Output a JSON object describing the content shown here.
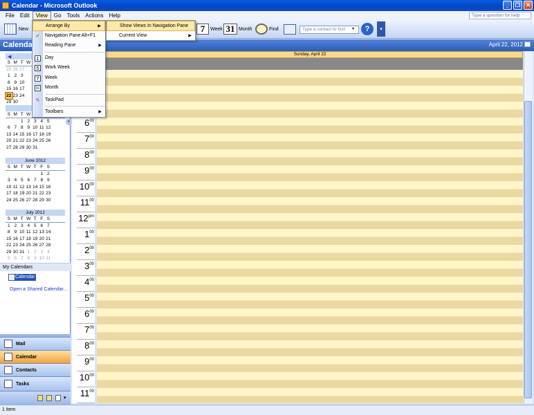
{
  "window": {
    "title": "Calendar - Microsoft Outlook"
  },
  "menubar": {
    "items": [
      "File",
      "Edit",
      "View",
      "Go",
      "Tools",
      "Actions",
      "Help"
    ],
    "help_placeholder": "Type a question for help"
  },
  "toolbar": {
    "new_label": "New",
    "week_label": "Week",
    "week_num": "7",
    "month_label": "Month",
    "month_num": "31",
    "find_label": "Find",
    "contact_placeholder": "Type a contact to find"
  },
  "view_menu": {
    "items": [
      {
        "label": "Arrange By",
        "submenu": true,
        "highlight": true
      },
      {
        "label": "Navigation Pane",
        "shortcut": "Alt+F1",
        "checked": true
      },
      {
        "label": "Reading Pane",
        "submenu": true
      },
      {
        "label": "Day",
        "icon": "1"
      },
      {
        "label": "Work Week",
        "icon": "5"
      },
      {
        "label": "Week",
        "icon": "7"
      },
      {
        "label": "Month",
        "icon": "31"
      },
      {
        "label": "TaskPad"
      },
      {
        "label": "Toolbars",
        "submenu": true
      }
    ]
  },
  "arrange_menu": {
    "items": [
      {
        "label": "Show Views In Navigation Pane",
        "highlight": true
      },
      {
        "label": "Current View",
        "submenu": true
      }
    ]
  },
  "nav": {
    "title": "Calendar",
    "my_calendars": "My Calendars",
    "calendar_item": "Calendar",
    "open_shared": "Open a Shared Calendar...",
    "buttons": [
      {
        "label": "Mail"
      },
      {
        "label": "Calendar",
        "selected": true
      },
      {
        "label": "Contacts"
      },
      {
        "label": "Tasks"
      }
    ]
  },
  "minicals": [
    {
      "title": "Apr",
      "dow": [
        "S",
        "M",
        "T",
        "W",
        "T",
        "F",
        "S"
      ],
      "rows": [
        [
          "25",
          "26",
          "27",
          "",
          "",
          "",
          ""
        ],
        [
          "1",
          "2",
          "3",
          "",
          "",
          "",
          ""
        ],
        [
          "8",
          "9",
          "10",
          "",
          "",
          "",
          ""
        ],
        [
          "15",
          "16",
          "17",
          "",
          "",
          "",
          ""
        ],
        [
          "22",
          "23",
          "24",
          "",
          "",
          "",
          ""
        ],
        [
          "29",
          "30",
          "",
          "",
          "",
          "",
          ""
        ]
      ],
      "today": "22"
    },
    {
      "title": "Ma",
      "dow": [
        "S",
        "M",
        "T",
        "W",
        "T",
        "F",
        "S"
      ],
      "rows": [
        [
          "",
          "",
          "1",
          "2",
          "3",
          "4",
          "5"
        ],
        [
          "6",
          "7",
          "8",
          "9",
          "10",
          "11",
          "12"
        ],
        [
          "13",
          "14",
          "15",
          "16",
          "17",
          "18",
          "19"
        ],
        [
          "20",
          "21",
          "22",
          "23",
          "24",
          "25",
          "26"
        ],
        [
          "27",
          "28",
          "29",
          "30",
          "31",
          "",
          ""
        ]
      ]
    },
    {
      "title": "June 2012",
      "dow": [
        "S",
        "M",
        "T",
        "W",
        "T",
        "F",
        "S"
      ],
      "rows": [
        [
          "",
          "",
          "",
          "",
          "",
          "1",
          "2"
        ],
        [
          "3",
          "4",
          "5",
          "6",
          "7",
          "8",
          "9"
        ],
        [
          "10",
          "11",
          "12",
          "13",
          "14",
          "15",
          "16"
        ],
        [
          "17",
          "18",
          "19",
          "20",
          "21",
          "22",
          "23"
        ],
        [
          "24",
          "25",
          "26",
          "27",
          "28",
          "29",
          "30"
        ]
      ]
    },
    {
      "title": "July 2012",
      "dow": [
        "S",
        "M",
        "T",
        "W",
        "T",
        "F",
        "S"
      ],
      "rows": [
        [
          "1",
          "2",
          "3",
          "4",
          "5",
          "6",
          "7"
        ],
        [
          "8",
          "9",
          "10",
          "11",
          "12",
          "13",
          "14"
        ],
        [
          "15",
          "16",
          "17",
          "18",
          "19",
          "20",
          "21"
        ],
        [
          "22",
          "23",
          "24",
          "25",
          "26",
          "27",
          "28"
        ],
        [
          "29",
          "30",
          "31",
          "1",
          "2",
          "3",
          "4"
        ],
        [
          "5",
          "6",
          "7",
          "8",
          "9",
          "10",
          "11"
        ]
      ]
    }
  ],
  "main": {
    "date_header": "April 22, 2012",
    "day_header": "Sunday, April 22",
    "hours": [
      {
        "h": "6",
        "s": "00"
      },
      {
        "h": "7",
        "s": "00"
      },
      {
        "h": "8",
        "s": "00"
      },
      {
        "h": "9",
        "s": "00"
      },
      {
        "h": "10",
        "s": "00"
      },
      {
        "h": "11",
        "s": "00"
      },
      {
        "h": "12",
        "s": "pm"
      },
      {
        "h": "1",
        "s": "00"
      },
      {
        "h": "2",
        "s": "00"
      },
      {
        "h": "3",
        "s": "00"
      },
      {
        "h": "4",
        "s": "00"
      },
      {
        "h": "5",
        "s": "00"
      },
      {
        "h": "6",
        "s": "00"
      },
      {
        "h": "7",
        "s": "00"
      },
      {
        "h": "8",
        "s": "00"
      },
      {
        "h": "9",
        "s": "00"
      },
      {
        "h": "10",
        "s": "00"
      },
      {
        "h": "11",
        "s": "00"
      }
    ]
  },
  "status": {
    "text": "1 Item"
  }
}
